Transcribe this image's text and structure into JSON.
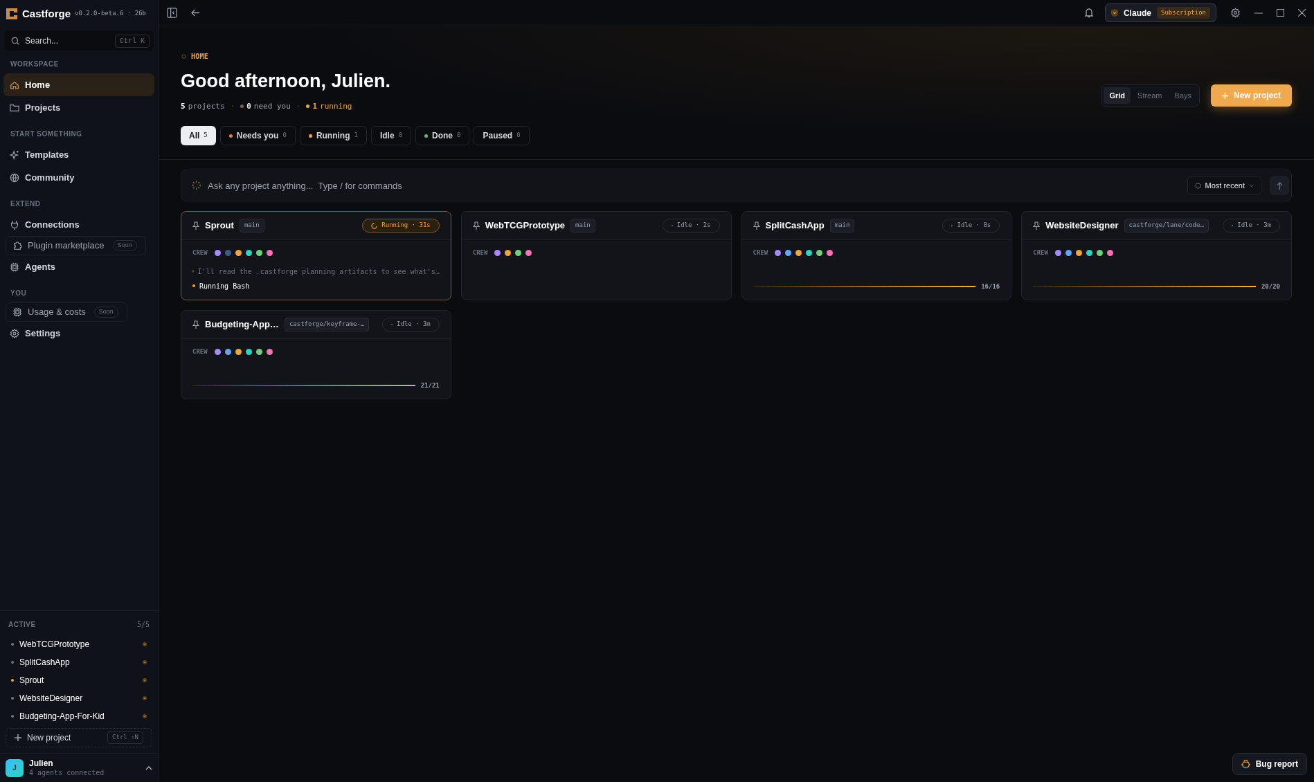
{
  "app": {
    "name": "Castforge",
    "version": "v0.2.0-beta.6 · 26b"
  },
  "search": {
    "placeholder": "Search...",
    "shortcut": "Ctrl K"
  },
  "sidebar": {
    "sections": [
      {
        "heading": "WORKSPACE",
        "items": [
          {
            "label": "Home",
            "selected": true
          },
          {
            "label": "Projects",
            "selected": false
          }
        ]
      },
      {
        "heading": "START SOMETHING",
        "items": [
          {
            "label": "Templates",
            "selected": false
          },
          {
            "label": "Community",
            "selected": false
          }
        ]
      },
      {
        "heading": "EXTEND",
        "items": [
          {
            "label": "Connections",
            "selected": false
          },
          {
            "label": "Plugin marketplace",
            "selected": false,
            "badge": "Soon"
          },
          {
            "label": "Agents",
            "selected": false
          }
        ]
      },
      {
        "heading": "YOU",
        "items": [
          {
            "label": "Usage & costs",
            "selected": false,
            "badge": "Soon"
          },
          {
            "label": "Settings",
            "selected": false
          }
        ]
      }
    ],
    "active": {
      "heading": "ACTIVE",
      "count": "5/5",
      "items": [
        {
          "label": "WebTCGPrototype",
          "color": "#6b7280"
        },
        {
          "label": "SplitCashApp",
          "color": "#6b7280"
        },
        {
          "label": "Sprout",
          "color": "#f0a43c"
        },
        {
          "label": "WebsiteDesigner",
          "color": "#6b7280"
        },
        {
          "label": "Budgeting-App-For-Kid",
          "color": "#6b7280"
        }
      ]
    },
    "new_project": {
      "label": "New project",
      "shortcut": "Ctrl ⇧N"
    },
    "user": {
      "initial": "J",
      "name": "Julien",
      "subtitle": "4 agents connected"
    }
  },
  "topbar": {
    "provider": "Claude",
    "plan": "Subscription"
  },
  "header": {
    "breadcrumb": "HOME",
    "title": "Good afternoon, Julien.",
    "stats": [
      {
        "value": "5",
        "label": "projects"
      },
      {
        "separator": "·",
        "value": "0",
        "label": "need you",
        "color": "#8a5a3a"
      },
      {
        "separator": "·",
        "value": "1",
        "label": "running",
        "color": "#f0a43c"
      }
    ],
    "views": [
      {
        "label": "Grid",
        "selected": true
      },
      {
        "label": "Stream",
        "selected": false
      },
      {
        "label": "Bays",
        "selected": false
      }
    ],
    "new_project": "New project"
  },
  "filters": [
    {
      "label": "All",
      "count": "5",
      "selected": true
    },
    {
      "label": "Needs you",
      "count": "0",
      "selected": false,
      "color": "#f07a3c"
    },
    {
      "label": "Running",
      "count": "1",
      "selected": false,
      "color": "#f0a43c"
    },
    {
      "label": "Idle",
      "count": "0",
      "selected": false
    },
    {
      "label": "Done",
      "count": "0",
      "selected": false,
      "color": "#5fbf7a"
    },
    {
      "label": "Paused",
      "count": "0",
      "selected": false
    }
  ],
  "ask": {
    "placeholder": "Ask any project anything...  Type / for commands",
    "sort": "Most recent"
  },
  "projects": [
    {
      "name": "Sprout",
      "branch": "main",
      "kind": "running",
      "status_text": "Running · 31s",
      "crew_label": "CREW",
      "crew": [
        {
          "color": "#a78bfa"
        },
        {
          "color": "#3b5b86"
        },
        {
          "color": "#f0a43c"
        },
        {
          "color": "#2dd4bf"
        },
        {
          "color": "#6fcf7f"
        },
        {
          "color": "#f472b6"
        }
      ],
      "activity": [
        {
          "kind": "message",
          "text": "I'll read the .castforge planning artifacts to see what's…"
        },
        {
          "kind": "tool",
          "text": "Running Bash"
        }
      ]
    },
    {
      "name": "WebTCGPrototype",
      "branch": "main",
      "kind": "idle",
      "status_text": "Idle · 2s",
      "crew_label": "CREW",
      "crew": [
        {
          "color": "#a78bfa"
        },
        {
          "color": "#f0a43c"
        },
        {
          "color": "#6fcf7f"
        },
        {
          "color": "#f472b6"
        }
      ]
    },
    {
      "name": "SplitCashApp",
      "branch": "main",
      "kind": "idle",
      "status_text": "Idle · 8s",
      "crew_label": "CREW",
      "crew": [
        {
          "color": "#a78bfa"
        },
        {
          "color": "#60a5fa"
        },
        {
          "color": "#f0a43c"
        },
        {
          "color": "#2dd4bf"
        },
        {
          "color": "#6fcf7f"
        },
        {
          "color": "#f472b6"
        }
      ],
      "progress": {
        "level": 1,
        "reading": "16/16"
      }
    },
    {
      "name": "WebsiteDesigner",
      "branch": "castforge/lane/code…",
      "kind": "idle",
      "status_text": "Idle · 3m",
      "crew_label": "CREW",
      "crew": [
        {
          "color": "#a78bfa"
        },
        {
          "color": "#60a5fa"
        },
        {
          "color": "#f0a43c"
        },
        {
          "color": "#2dd4bf"
        },
        {
          "color": "#6fcf7f"
        },
        {
          "color": "#f472b6"
        }
      ],
      "progress": {
        "level": 1,
        "reading": "20/20"
      }
    },
    {
      "name": "Budgeting-App…",
      "branch": "castforge/keyframe-…",
      "kind": "idle",
      "status_text": "Idle · 3m",
      "crew_label": "CREW",
      "crew": [
        {
          "color": "#a78bfa"
        },
        {
          "color": "#60a5fa"
        },
        {
          "color": "#f0a43c"
        },
        {
          "color": "#2dd4bf"
        },
        {
          "color": "#6fcf7f"
        },
        {
          "color": "#f472b6"
        }
      ],
      "progress": {
        "level": 1,
        "reading": "21/21"
      }
    }
  ],
  "bug_report": "Bug report"
}
